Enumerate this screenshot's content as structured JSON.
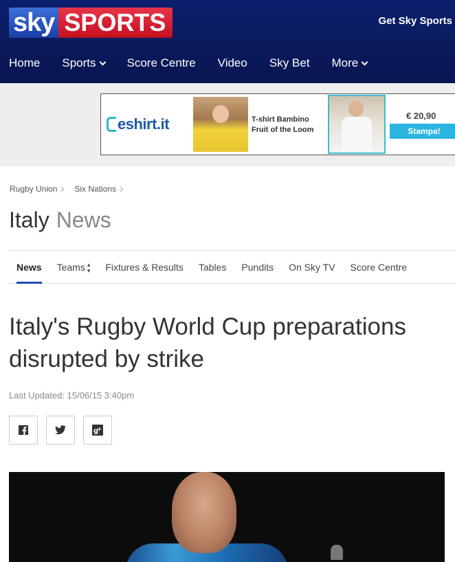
{
  "header": {
    "logo_sky": "sky",
    "logo_sports": "SPORTS",
    "get_sky_sports": "Get Sky Sports",
    "nav": [
      {
        "label": "Home"
      },
      {
        "label": "Sports",
        "has_dropdown": true
      },
      {
        "label": "Score Centre"
      },
      {
        "label": "Video"
      },
      {
        "label": "Sky Bet"
      },
      {
        "label": "More",
        "has_dropdown": true
      }
    ]
  },
  "ad": {
    "brand": "eshirt.it",
    "product_text_line1": "T-shirt Bambino",
    "product_text_line2": "Fruit of the Loom",
    "price": "€ 20,90",
    "cta": "Stampa!"
  },
  "breadcrumb": [
    "Rugby Union",
    "Six Nations"
  ],
  "page_title": {
    "main": "Italy",
    "sub": "News"
  },
  "tabs": [
    {
      "label": "News",
      "active": true
    },
    {
      "label": "Teams",
      "sortable": true
    },
    {
      "label": "Fixtures & Results"
    },
    {
      "label": "Tables"
    },
    {
      "label": "Pundits"
    },
    {
      "label": "On Sky TV"
    },
    {
      "label": "Score Centre"
    }
  ],
  "article": {
    "headline": "Italy's Rugby World Cup preparations disrupted by strike",
    "last_updated": "Last Updated: 15/06/15 3:40pm"
  },
  "share": [
    {
      "icon": "facebook-icon"
    },
    {
      "icon": "twitter-icon"
    },
    {
      "icon": "google-plus-icon"
    }
  ],
  "colors": {
    "header_bg": "#0a1a5c",
    "sports_red": "#c4101f",
    "tab_active": "#1c4fb5",
    "ad_button": "#2ab4e0"
  }
}
